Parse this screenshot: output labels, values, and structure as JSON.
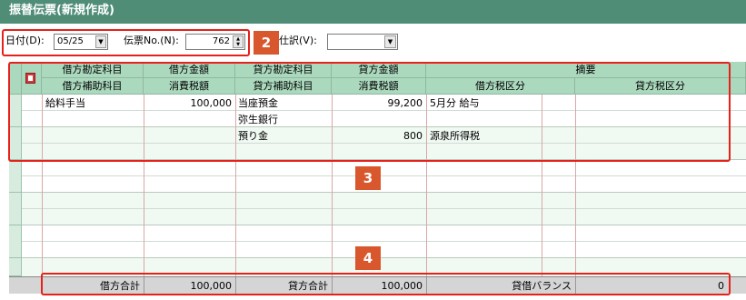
{
  "window": {
    "title": "振替伝票(新規作成)"
  },
  "toolbar": {
    "date_label": "日付(D):",
    "date_value": "05/25",
    "slip_no_label": "伝票No.(N):",
    "slip_no_value": "762",
    "journal_label": "仕訳(V):",
    "journal_value": ""
  },
  "badges": {
    "b2": "2",
    "b3": "3",
    "b4": "4"
  },
  "table": {
    "header_row1": [
      "借方勘定科目",
      "借方金額",
      "貸方勘定科目",
      "貸方金額",
      "摘要"
    ],
    "header_row2": [
      "借方補助科目",
      "消費税額",
      "貸方補助科目",
      "消費税額",
      "借方税区分",
      "貸方税区分"
    ],
    "rows": [
      {
        "debit_account": "給料手当",
        "debit_amount": "100,000",
        "credit_account": "当座預金",
        "credit_amount": "99,200",
        "memo": "5月分 給与"
      },
      {
        "debit_account": "",
        "debit_amount": "",
        "credit_account": "弥生銀行",
        "credit_amount": "",
        "memo": ""
      },
      {
        "debit_account": "",
        "debit_amount": "",
        "credit_account": "預り金",
        "credit_amount": "800",
        "memo": "源泉所得税"
      }
    ]
  },
  "totals": {
    "debit_total_label": "借方合計",
    "debit_total": "100,000",
    "credit_total_label": "貸方合計",
    "credit_total": "100,000",
    "balance_label": "貸借バランス",
    "balance": "0"
  },
  "colors": {
    "title_bar": "#4f8d77",
    "header": "#abd9be",
    "highlight": "#e8201a",
    "badge": "#d9572c"
  }
}
